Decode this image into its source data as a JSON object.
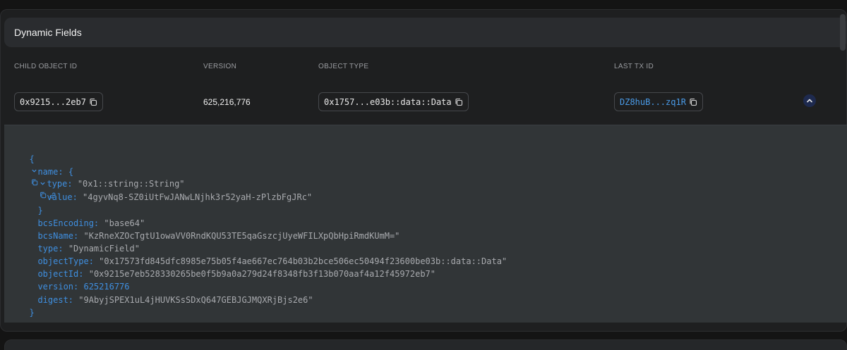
{
  "section": {
    "title": "Dynamic Fields"
  },
  "table": {
    "headers": [
      "CHILD OBJECT ID",
      "VERSION",
      "OBJECT TYPE",
      "LAST TX ID"
    ],
    "row": {
      "child_object_id": "0x9215...2eb7",
      "version": "625,216,776",
      "object_type": "0x1757...e03b::data::Data",
      "last_tx_id": "DZ8huB...zq1R"
    }
  },
  "json_view": {
    "open_brace": "{",
    "close_brace": "}",
    "name_key": "name:",
    "name_open": "{",
    "name_close": "}",
    "type_key": "type:",
    "type_value": "\"0x1::string::String\"",
    "value_key": "value:",
    "value_value": "\"4gyvNq8-SZ0iUtFwJANwLNjhk3r52yaH-zPlzbFgJRc\"",
    "bcsEncoding_key": "bcsEncoding:",
    "bcsEncoding_value": "\"base64\"",
    "bcsName_key": "bcsName:",
    "bcsName_value": "\"KzRneXZOcTgtU1owaVV0RndKQU53TE5qaGszcjUyeWFILXpQbHpiRmdKUmM=\"",
    "type2_key": "type:",
    "type2_value": "\"DynamicField\"",
    "objectType_key": "objectType:",
    "objectType_value": "\"0x17573fd845dfc8985e75b05f4ae667ec764b03b2bce506ec50494f23600be03b::data::Data\"",
    "objectId_key": "objectId:",
    "objectId_value": "\"0x9215e7eb528330265be0f5b9a0a279d24f8348fb3f13b070aaf4a12f45972eb7\"",
    "version_key": "version:",
    "version_value": "625216776",
    "digest_key": "digest:",
    "digest_value": "\"9AbyjSPEX1uL4jHUVKSsSDxQ647GEBJGJMQXRjBjs2e6\""
  },
  "colors": {
    "accent": "#3f8fe0",
    "link": "#4a9be8",
    "background": "#141414",
    "panel": "#313537"
  },
  "icons": [
    "copy-icon",
    "chevron-up-icon",
    "chevron-down-icon"
  ]
}
